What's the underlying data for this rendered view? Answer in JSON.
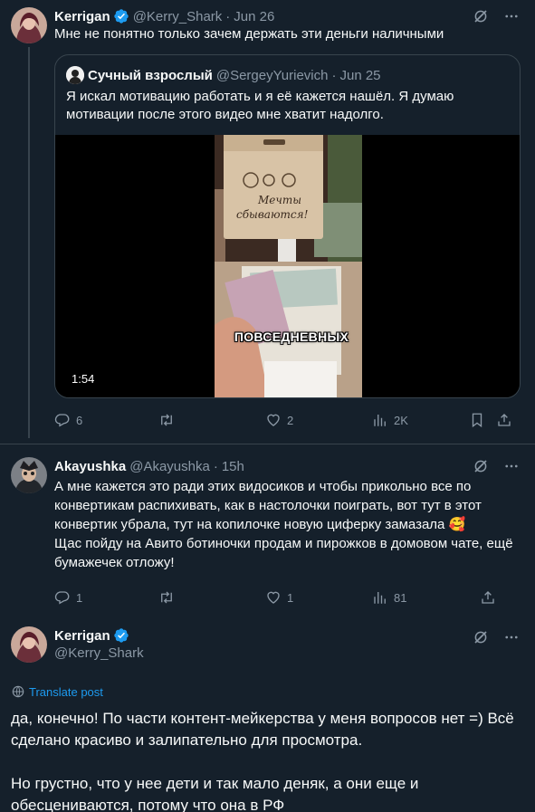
{
  "thread": [
    {
      "name": "Kerrigan",
      "handle": "@Kerry_Shark",
      "time": "Jun 26",
      "text": "Мне не понятно только зачем держать эти деньги наличными",
      "quote": {
        "name": "Сучный взрослый",
        "handle": "@SergeyYurievich",
        "time": "Jun 25",
        "text": "Я искал мотивацию работать и я её кажется нашёл. Я думаю мотивации после этого видео мне хватит надолго.",
        "video_duration": "1:54",
        "video_caption": "ПОВСЕДНЕВНЫХ",
        "box_text_line1": "Мечты",
        "box_text_line2": "сбываются!"
      },
      "stats": {
        "replies": "6",
        "reposts": "",
        "likes": "2",
        "views": "2K"
      }
    },
    {
      "name": "Akayushka",
      "handle": "@Akayushka",
      "time": "15h",
      "text": "А мне кажется это ради этих видосиков и чтобы прикольно все по конвертикам распихивать, как в настолочки поиграть, вот тут в этот конвертик убрала, тут на копилочке новую циферку замазала 🥰\nЩас пойду на Авито ботиночки продам и пирожков в домовом чате, ещё бумажечек отложу!",
      "stats": {
        "replies": "1",
        "reposts": "",
        "likes": "1",
        "views": "81"
      }
    }
  ],
  "focus": {
    "name": "Kerrigan",
    "handle": "@Kerry_Shark",
    "translate": "Translate post",
    "text": "да, конечно! По части контент-мейкерства у меня вопросов нет =) Всё сделано красиво и залипательно для просмотра.\n\nНо грустно, что у нее дети и так мало деняк, а они еще и обесцениваются, потому что она в РФ"
  },
  "icons": {
    "verified": "verified-badge-icon",
    "grok": "grok-icon",
    "more": "more-icon",
    "reply": "reply-icon",
    "repost": "repost-icon",
    "like": "like-icon",
    "views": "views-icon",
    "bookmark": "bookmark-icon",
    "share": "share-icon",
    "translate": "globe-icon"
  },
  "colors": {
    "background": "#15202b",
    "text": "#f7f9f9",
    "muted": "#8b98a5",
    "accent": "#1d9bf0",
    "border": "#38444d"
  }
}
